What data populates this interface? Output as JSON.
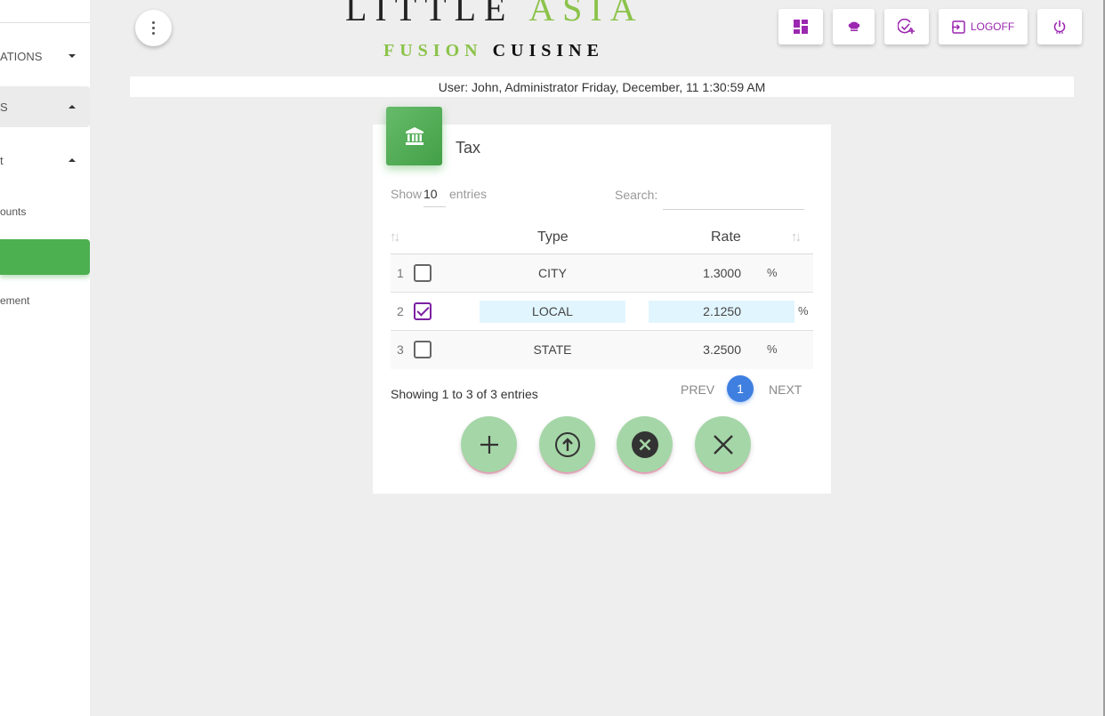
{
  "sidebar": {
    "items": [
      {
        "label": "ATIONS",
        "caret": "down"
      },
      {
        "label": "S",
        "caret": "up"
      },
      {
        "label": "t",
        "caret": "up"
      },
      {
        "label": "ounts"
      },
      {
        "label": ""
      },
      {
        "label": "ement"
      }
    ],
    "active_color": "#4caf50"
  },
  "logo": {
    "line1_word1": "LITTLE",
    "line1_word2": "ASIA",
    "line2_word1": "FUSION",
    "line2_word2": "CUISINE",
    "accent_color": "#8bc34a"
  },
  "toolbar": {
    "dashboard_icon": "dashboard-icon",
    "chef_icon": "chef-hat-icon",
    "checkin_icon": "check-add-icon",
    "logoff_label": "LOGOFF",
    "power_icon": "power-icon",
    "icon_color": "#9c27b0"
  },
  "status": {
    "text": "User: John, Administrator Friday, December, 11 1:30:59 AM"
  },
  "card": {
    "icon": "bank-icon",
    "title": "Tax",
    "show_label": "Show",
    "show_value": "10",
    "entries_label": "entries",
    "search_label": "Search:",
    "search_value": "",
    "columns": {
      "type": "Type",
      "rate": "Rate"
    },
    "rows": [
      {
        "num": "1",
        "checked": false,
        "type": "CITY",
        "rate": "1.3000",
        "unit": "%"
      },
      {
        "num": "2",
        "checked": true,
        "type": "LOCAL",
        "rate": "2.1250",
        "unit": "%"
      },
      {
        "num": "3",
        "checked": false,
        "type": "STATE",
        "rate": "3.2500",
        "unit": "%"
      }
    ],
    "showing_text": "Showing 1 to 3 of 3 entries",
    "prev_label": "PREV",
    "page": "1",
    "next_label": "NEXT"
  },
  "actions": {
    "add_icon": "plus-icon",
    "upload_icon": "upload-circle-icon",
    "cancel_icon": "x-circle-icon",
    "close_icon": "close-icon",
    "fab_color": "#a5d6a7"
  }
}
